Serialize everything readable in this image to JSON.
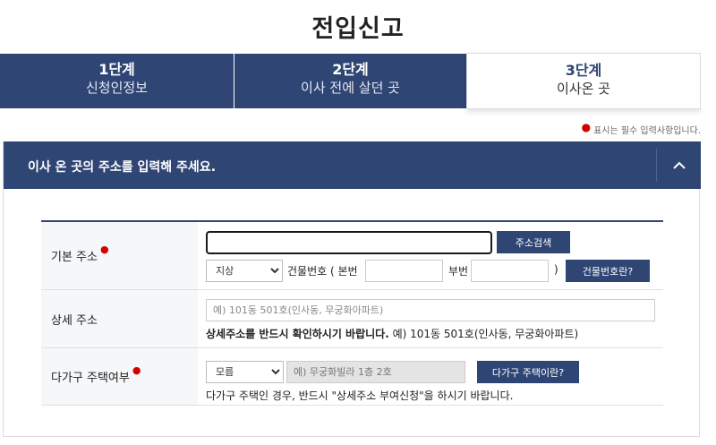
{
  "page": {
    "title": "전입신고"
  },
  "steps": [
    {
      "num": "1단계",
      "name": "신청인정보",
      "active": false
    },
    {
      "num": "2단계",
      "name": "이사 전에 살던 곳",
      "active": false
    },
    {
      "num": "3단계",
      "name": "이사온 곳",
      "active": true
    }
  ],
  "required_note": "표시는 필수 입력사항입니다.",
  "panel": {
    "title": "이사 온 곳의 주소를 입력해 주세요."
  },
  "form": {
    "basic_address": {
      "label": "기본 주소",
      "search_button": "주소검색",
      "lot_type_selected": "지상",
      "building_number_label": "건물번호 ( 본번",
      "sub_number_label": "부번",
      "close_paren": ")",
      "building_help_button": "건물번호란?"
    },
    "detail_address": {
      "label": "상세 주소",
      "placeholder": "예) 101동 501호(인사동, 무궁화아파트)",
      "help_bold": "상세주소를 반드시 확인하시기 바랍니다.",
      "help_rest": " 예) 101동 501호(인사동, 무궁화아파트)"
    },
    "multi_household": {
      "label": "다가구 주택여부",
      "selected": "모름",
      "placeholder": "예) 무궁화빌라 1층 2호",
      "help_button": "다가구 주택이란?",
      "help_text": "다가구 주택인 경우, 반드시 \"상세주소 부여신청\"을 하시기 바랍니다."
    }
  },
  "colors": {
    "primary": "#2f4574",
    "required": "#d40000"
  }
}
